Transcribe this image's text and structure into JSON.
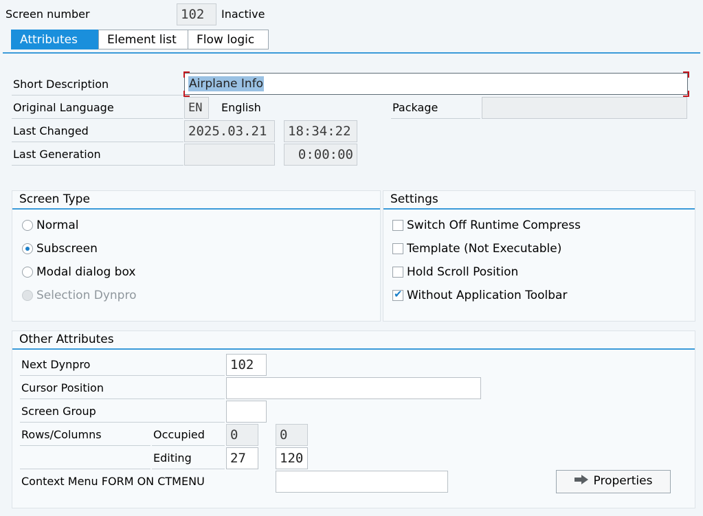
{
  "header": {
    "screen_number_label": "Screen number",
    "screen_number": "102",
    "status": "Inactive"
  },
  "tabs": [
    {
      "label": "Attributes",
      "active": true
    },
    {
      "label": "Element list",
      "active": false
    },
    {
      "label": "Flow logic",
      "active": false
    }
  ],
  "attributes": {
    "short_description_label": "Short Description",
    "short_description": "Airplane Info",
    "original_language_label": "Original Language",
    "language_code": "EN",
    "language_name": "English",
    "package_label": "Package",
    "package_value": "",
    "last_changed_label": "Last Changed",
    "last_changed_date": "2025.03.21",
    "last_changed_time": "18:34:22",
    "last_generation_label": "Last Generation",
    "last_generation_date": "",
    "last_generation_time": "0:00:00"
  },
  "screen_type": {
    "title": "Screen Type",
    "options": [
      {
        "label": "Normal",
        "selected": false,
        "enabled": true
      },
      {
        "label": "Subscreen",
        "selected": true,
        "enabled": true
      },
      {
        "label": "Modal dialog box",
        "selected": false,
        "enabled": true
      },
      {
        "label": "Selection Dynpro",
        "selected": false,
        "enabled": false
      }
    ]
  },
  "settings": {
    "title": "Settings",
    "options": [
      {
        "label": "Switch Off Runtime Compress",
        "checked": false
      },
      {
        "label": "Template (Not Executable)",
        "checked": false
      },
      {
        "label": "Hold Scroll Position",
        "checked": false
      },
      {
        "label": "Without Application Toolbar",
        "checked": true
      }
    ]
  },
  "other": {
    "title": "Other Attributes",
    "next_dynpro_label": "Next Dynpro",
    "next_dynpro": "102",
    "cursor_position_label": "Cursor Position",
    "cursor_position": "",
    "screen_group_label": "Screen Group",
    "screen_group": "",
    "rows_columns_label": "Rows/Columns",
    "occupied_label": "Occupied",
    "occupied_rows": "0",
    "occupied_cols": "0",
    "editing_label": "Editing",
    "editing_rows": "27",
    "editing_cols": "120",
    "context_menu_label": "Context Menu FORM ON CTMENU",
    "context_menu": "",
    "properties_button": "Properties"
  },
  "icons": {
    "properties": "arrow-right-icon"
  }
}
